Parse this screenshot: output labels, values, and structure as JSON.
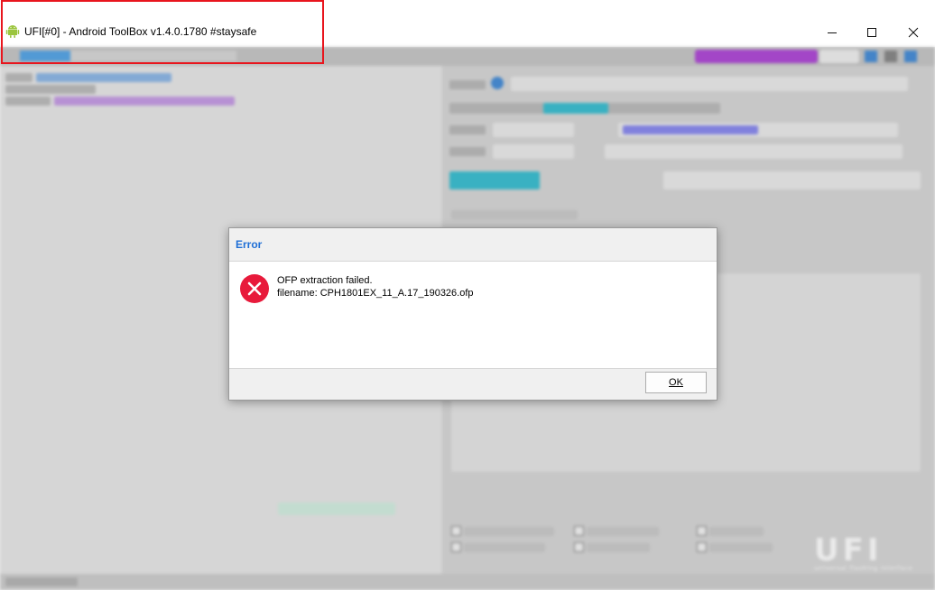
{
  "window": {
    "title": "UFI[#0] - Android ToolBox v1.4.0.1780 #staysafe",
    "app_icon": "android-icon",
    "controls": [
      "minimize-icon",
      "maximize-icon",
      "close-icon"
    ]
  },
  "dialog": {
    "title": "Error",
    "icon": "error-icon",
    "message_line1": "OFP extraction failed.",
    "message_line2": "filename: CPH1801EX_11_A.17_190326.ofp",
    "ok_label": "OK"
  },
  "background": {
    "watermark": "UFI",
    "watermark_sub": "universal flashing interface"
  },
  "colors": {
    "highlight_box": "#e8151d",
    "dialog_title": "#1f6fd6",
    "error_icon": "#e81a3b",
    "accent_purple": "#b14cd8",
    "accent_teal": "#3ec1d3"
  }
}
